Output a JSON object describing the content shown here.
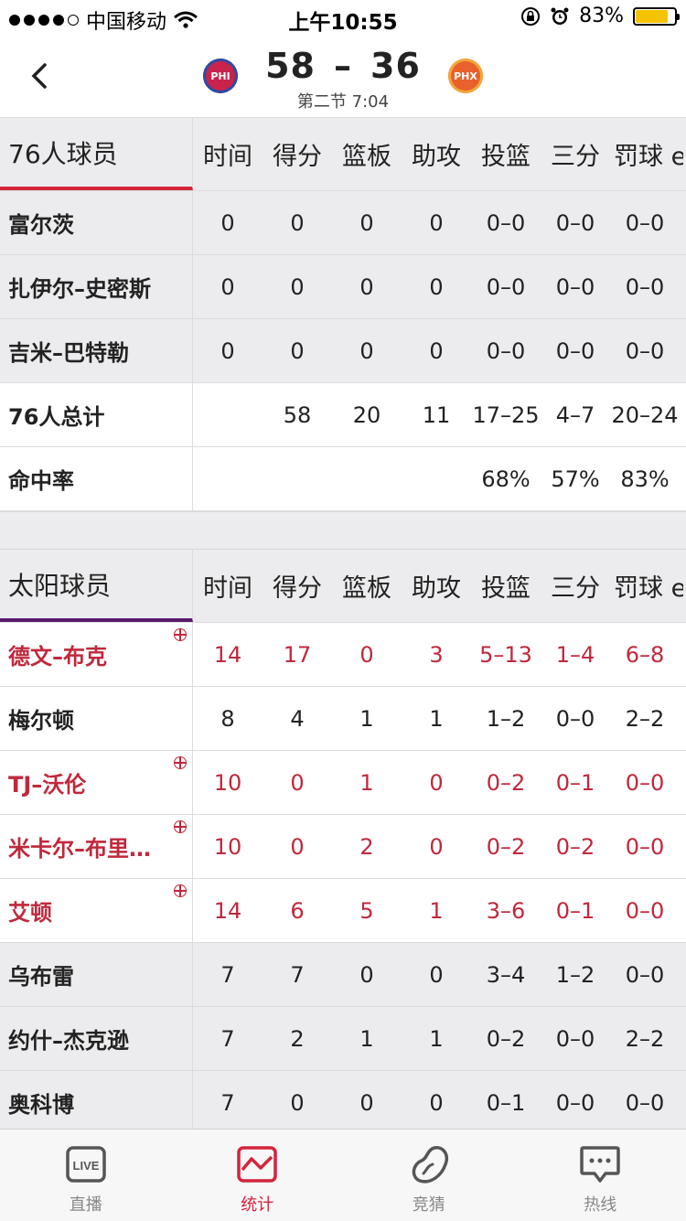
{
  "status_bar": {
    "carrier": "中国移动",
    "time": "上午10:55",
    "battery_percent": "83%",
    "battery_level": 0.83,
    "battery_color": "#f5c400"
  },
  "header": {
    "home_logo": "PHI",
    "away_logo": "PHX",
    "home_score": "58",
    "separator": "–",
    "away_score": "36",
    "period": "第二节 7:04"
  },
  "phi": {
    "header": [
      "76人球员",
      "时间",
      "得分",
      "篮板",
      "助攻",
      "投篮",
      "三分",
      "罚球 e"
    ],
    "players": [
      {
        "name": "富尔茨",
        "stats": [
          "0",
          "0",
          "0",
          "0",
          "0–0",
          "0–0",
          "0–0"
        ]
      },
      {
        "name": "扎伊尔–史密斯",
        "stats": [
          "0",
          "0",
          "0",
          "0",
          "0–0",
          "0–0",
          "0–0"
        ]
      },
      {
        "name": "吉米–巴特勒",
        "stats": [
          "0",
          "0",
          "0",
          "0",
          "0–0",
          "0–0",
          "0–0"
        ]
      }
    ],
    "total": {
      "name": "76人总计",
      "stats": [
        "",
        "58",
        "20",
        "11",
        "17–25",
        "4–7",
        "20–24"
      ]
    },
    "pct": {
      "name": "命中率",
      "stats": [
        "",
        "",
        "",
        "",
        "68%",
        "57%",
        "83%"
      ]
    }
  },
  "phx": {
    "header": [
      "太阳球员",
      "时间",
      "得分",
      "篮板",
      "助攻",
      "投篮",
      "三分",
      "罚球 e"
    ],
    "players": [
      {
        "name": "德文–布克",
        "stats": [
          "14",
          "17",
          "0",
          "3",
          "5–13",
          "1–4",
          "6–8"
        ],
        "starter": true,
        "bg": "white"
      },
      {
        "name": "梅尔顿",
        "stats": [
          "8",
          "4",
          "1",
          "1",
          "1–2",
          "0–0",
          "2–2"
        ],
        "starter": false,
        "bg": "white"
      },
      {
        "name": "TJ–沃伦",
        "stats": [
          "10",
          "0",
          "1",
          "0",
          "0–2",
          "0–1",
          "0–0"
        ],
        "starter": true,
        "bg": "white"
      },
      {
        "name": "米卡尔–布里…",
        "stats": [
          "10",
          "0",
          "2",
          "0",
          "0–2",
          "0–2",
          "0–0"
        ],
        "starter": true,
        "bg": "white"
      },
      {
        "name": "艾顿",
        "stats": [
          "14",
          "6",
          "5",
          "1",
          "3–6",
          "0–1",
          "0–0"
        ],
        "starter": true,
        "bg": "white"
      },
      {
        "name": "乌布雷",
        "stats": [
          "7",
          "7",
          "0",
          "0",
          "3–4",
          "1–2",
          "0–0"
        ],
        "starter": false,
        "bg": "gray"
      },
      {
        "name": "约什–杰克逊",
        "stats": [
          "7",
          "2",
          "1",
          "1",
          "0–2",
          "0–0",
          "2–2"
        ],
        "starter": false,
        "bg": "gray"
      },
      {
        "name": "奥科博",
        "stats": [
          "7",
          "0",
          "0",
          "0",
          "0–1",
          "0–0",
          "0–0"
        ],
        "starter": false,
        "bg": "gray"
      }
    ]
  },
  "tabs": [
    {
      "label": "直播",
      "icon": "live-icon",
      "active": false
    },
    {
      "label": "统计",
      "icon": "chart-icon",
      "active": true
    },
    {
      "label": "竞猜",
      "icon": "bean-icon",
      "active": false
    },
    {
      "label": "热线",
      "icon": "chat-icon",
      "active": false
    }
  ],
  "colors": {
    "accent": "#d4243d",
    "phi": "#c8234b",
    "phx": "#e8612c"
  }
}
